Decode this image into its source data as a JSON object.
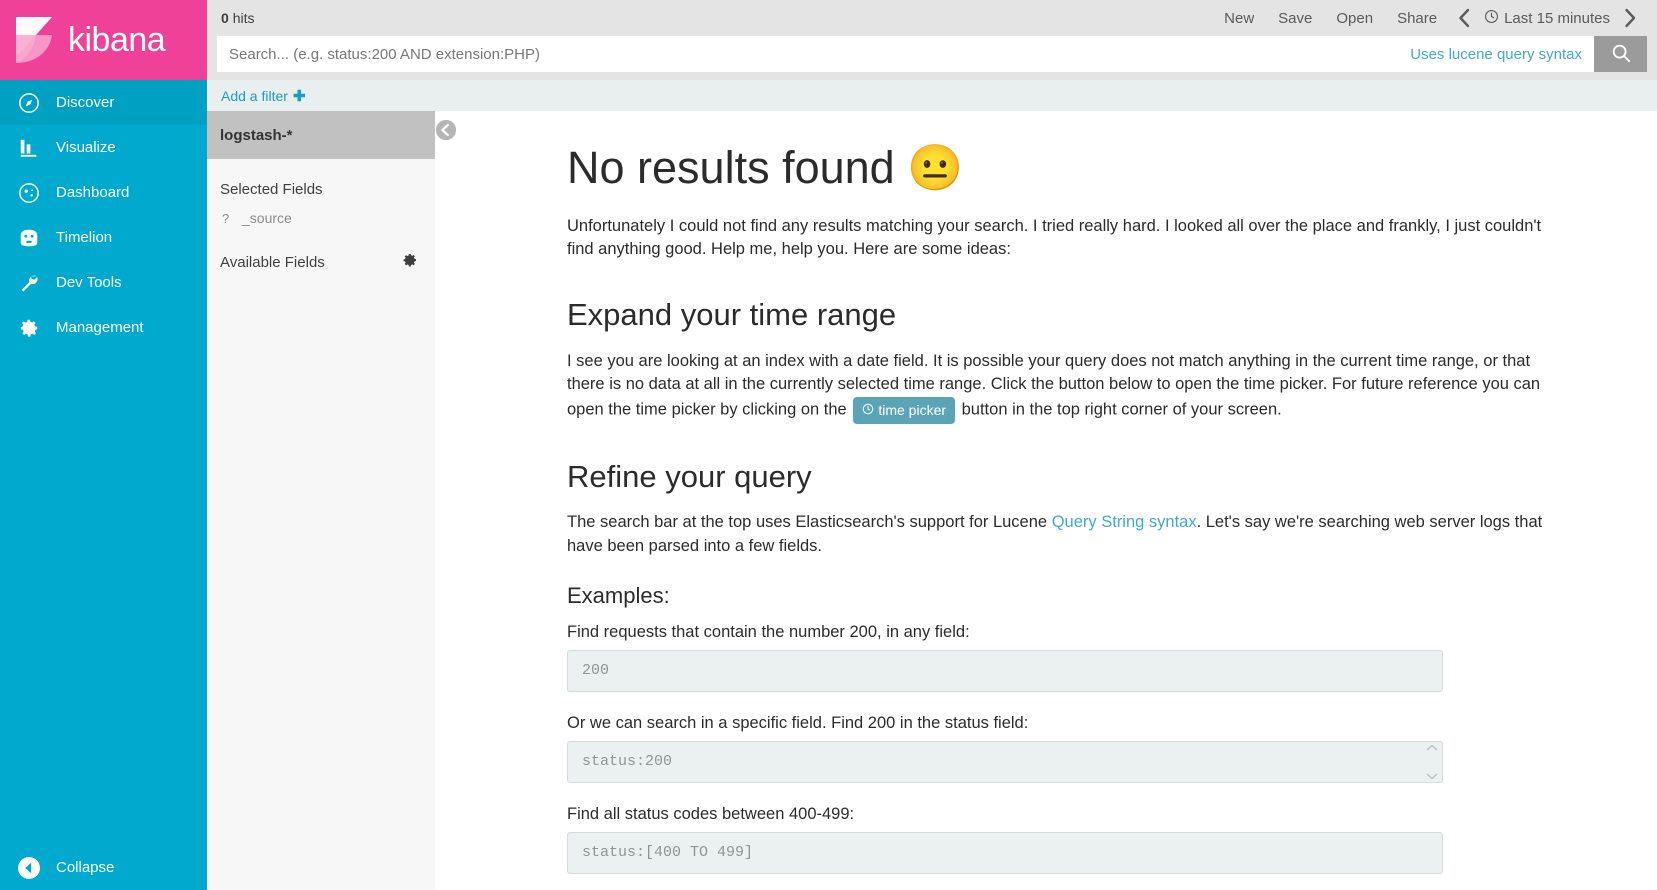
{
  "brand": {
    "name": "kibana",
    "logo_icon": "kibana-logo-icon"
  },
  "sidebar": {
    "items": [
      {
        "label": "Discover",
        "icon": "compass-icon",
        "active": true
      },
      {
        "label": "Visualize",
        "icon": "bar-chart-icon",
        "active": false
      },
      {
        "label": "Dashboard",
        "icon": "dashboard-icon",
        "active": false
      },
      {
        "label": "Timelion",
        "icon": "timelion-icon",
        "active": false
      },
      {
        "label": "Dev Tools",
        "icon": "wrench-icon",
        "active": false
      },
      {
        "label": "Management",
        "icon": "gear-icon",
        "active": false
      }
    ],
    "collapse": {
      "label": "Collapse",
      "icon": "chevron-left-circle-icon"
    }
  },
  "topbar": {
    "hits_count": "0",
    "hits_label": "hits",
    "actions": [
      {
        "label": "New"
      },
      {
        "label": "Save"
      },
      {
        "label": "Open"
      },
      {
        "label": "Share"
      }
    ],
    "prev_icon": "chevron-left-icon",
    "next_icon": "chevron-right-icon",
    "time_range": "Last 15 minutes",
    "clock_icon": "clock-icon"
  },
  "search": {
    "value": "",
    "placeholder": "Search... (e.g. status:200 AND extension:PHP)",
    "lucene_link": "Uses lucene query syntax",
    "search_icon": "search-icon"
  },
  "filters": {
    "add_filter_label": "Add a filter",
    "plus_icon": "plus-icon"
  },
  "field_panel": {
    "index_pattern": "logstash-*",
    "selected_fields_label": "Selected Fields",
    "selected_fields": [
      {
        "type_glyph": "?",
        "name": "_source"
      }
    ],
    "available_fields_label": "Available Fields",
    "gear_icon": "gear-icon",
    "collapse_icon": "chevron-left-circle-icon"
  },
  "main": {
    "headline": "No results found 😐",
    "intro": "Unfortunately I could not find any results matching your search. I tried really hard. I looked all over the place and frankly, I just couldn't find anything good. Help me, help you. Here are some ideas:",
    "time_range_section": {
      "title": "Expand your time range",
      "text_part1": "I see you are looking at an index with a date field. It is possible your query does not match anything in the current time range, or that there is no data at all in the currently selected time range. Click the button below to open the time picker. For future reference you can open the time picker by clicking on the",
      "badge_label": "time picker",
      "badge_icon": "clock-icon",
      "badge_color": "#5ba4b5",
      "text_part2": "button in the top right corner of your screen."
    },
    "refine_section": {
      "title": "Refine your query",
      "text_part1": "The search bar at the top uses Elasticsearch's support for Lucene",
      "link_label": "Query String syntax",
      "text_part2": ". Let's say we're searching web server logs that have been parsed into a few fields.",
      "examples_title": "Examples:",
      "examples": [
        {
          "label": "Find requests that contain the number 200, in any field:",
          "value": "200",
          "has_spinner": false
        },
        {
          "label": "Or we can search in a specific field. Find 200 in the status field:",
          "value": "status:200",
          "has_spinner": true
        },
        {
          "label": "Find all status codes between 400-499:",
          "value": "status:[400 TO 499]",
          "has_spinner": false
        }
      ]
    }
  },
  "colors": {
    "brand_pink": "#f04199",
    "sidebar_cyan": "#00a9cd",
    "link_blue": "#3fa8d4",
    "badge_teal": "#5ba4b5"
  }
}
